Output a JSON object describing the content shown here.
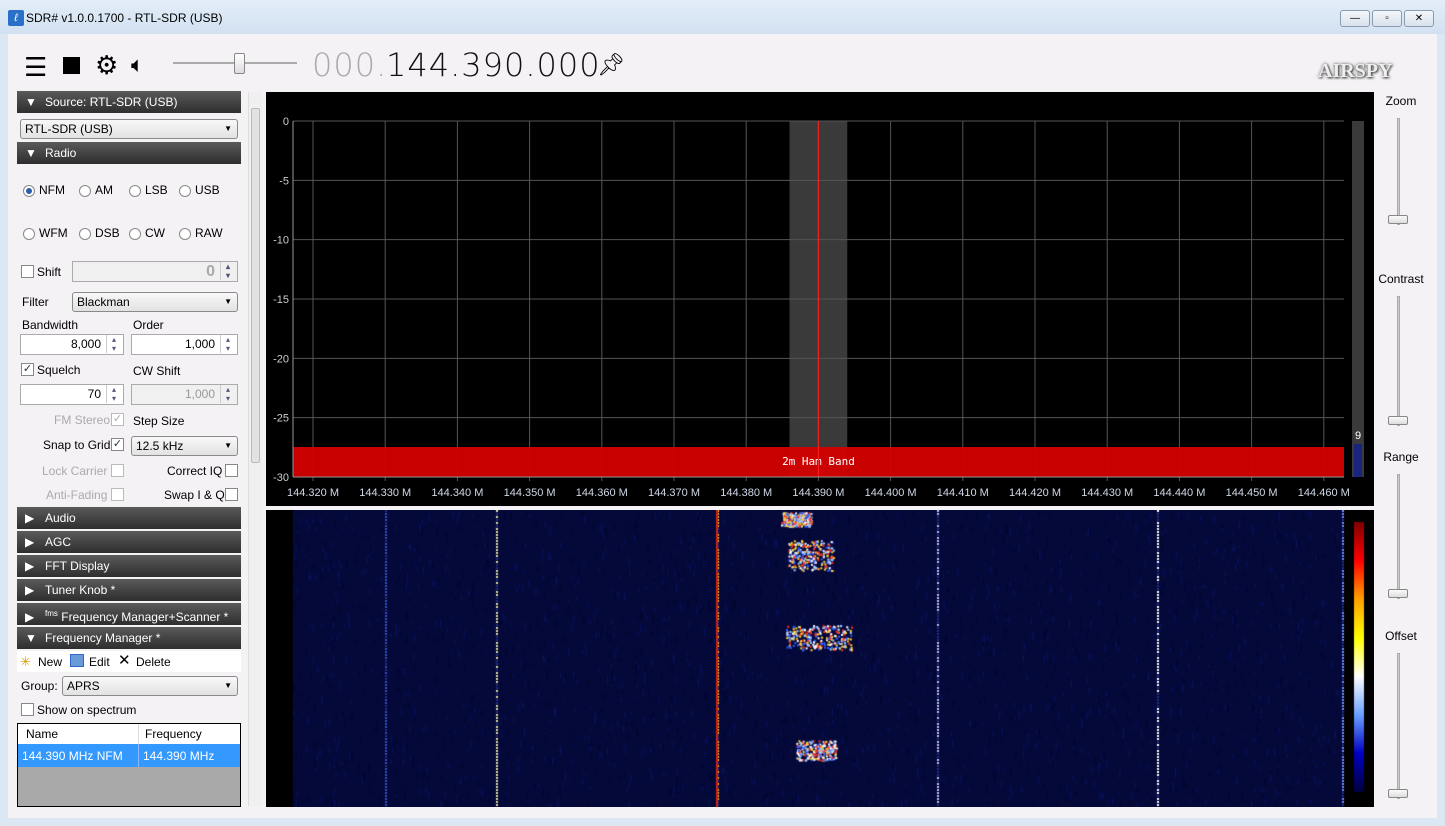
{
  "window": {
    "title": "SDR# v1.0.0.1700 - RTL-SDR (USB)",
    "minimize": "—",
    "maximize": "▫",
    "close": "✕"
  },
  "toolbar": {
    "freq_prefix": "000.",
    "frequency": "144.390.000",
    "volume_percent": 50,
    "logo": "AIRSPY"
  },
  "source": {
    "header": "Source: RTL-SDR (USB)",
    "device": "RTL-SDR (USB)"
  },
  "radio": {
    "header": "Radio",
    "modes": [
      {
        "label": "NFM",
        "selected": true
      },
      {
        "label": "AM"
      },
      {
        "label": "LSB"
      },
      {
        "label": "USB"
      },
      {
        "label": "WFM"
      },
      {
        "label": "DSB"
      },
      {
        "label": "CW"
      },
      {
        "label": "RAW"
      }
    ],
    "shift_label": "Shift",
    "shift_value": "0",
    "filter_label": "Filter",
    "filter_value": "Blackman",
    "bandwidth_label": "Bandwidth",
    "bandwidth_value": "8,000",
    "order_label": "Order",
    "order_value": "1,000",
    "squelch_label": "Squelch",
    "squelch_value": "70",
    "cw_shift_label": "CW Shift",
    "cw_shift_value": "1,000",
    "fm_stereo_label": "FM Stereo",
    "step_size_label": "Step Size",
    "step_size_value": "12.5 kHz",
    "snap_label": "Snap to Grid",
    "lock_carrier_label": "Lock Carrier",
    "correct_iq_label": "Correct IQ",
    "anti_fading_label": "Anti-Fading",
    "swap_iq_label": "Swap I & Q"
  },
  "panels": [
    "Audio",
    "AGC",
    "FFT Display",
    "Tuner Knob *",
    "Frequency Manager+Scanner *"
  ],
  "panel_prefix_fms": "fms",
  "freq_manager": {
    "header": "Frequency Manager *",
    "new": "New",
    "edit": "Edit",
    "delete": "Delete",
    "group_label": "Group:",
    "group_value": "APRS",
    "show_on_spectrum": "Show on spectrum",
    "columns": [
      "Name",
      "Frequency"
    ],
    "rows": [
      {
        "name": "144.390 MHz NFM",
        "frequency": "144.390 MHz"
      }
    ]
  },
  "spectrum": {
    "y_ticks": [
      "0",
      "-5",
      "-10",
      "-15",
      "-20",
      "-25",
      "-30"
    ],
    "x_ticks": [
      "144.320 M",
      "144.330 M",
      "144.340 M",
      "144.350 M",
      "144.360 M",
      "144.370 M",
      "144.380 M",
      "144.390 M",
      "144.400 M",
      "144.410 M",
      "144.420 M",
      "144.430 M",
      "144.440 M",
      "144.450 M",
      "144.460 M"
    ],
    "band_label": "2m Ham Band",
    "band_color": "#d40000",
    "tuned_color": "#ff2020",
    "snr_value": "9"
  },
  "side": {
    "zoom": "Zoom",
    "contrast": "Contrast",
    "range": "Range",
    "offset": "Offset"
  }
}
